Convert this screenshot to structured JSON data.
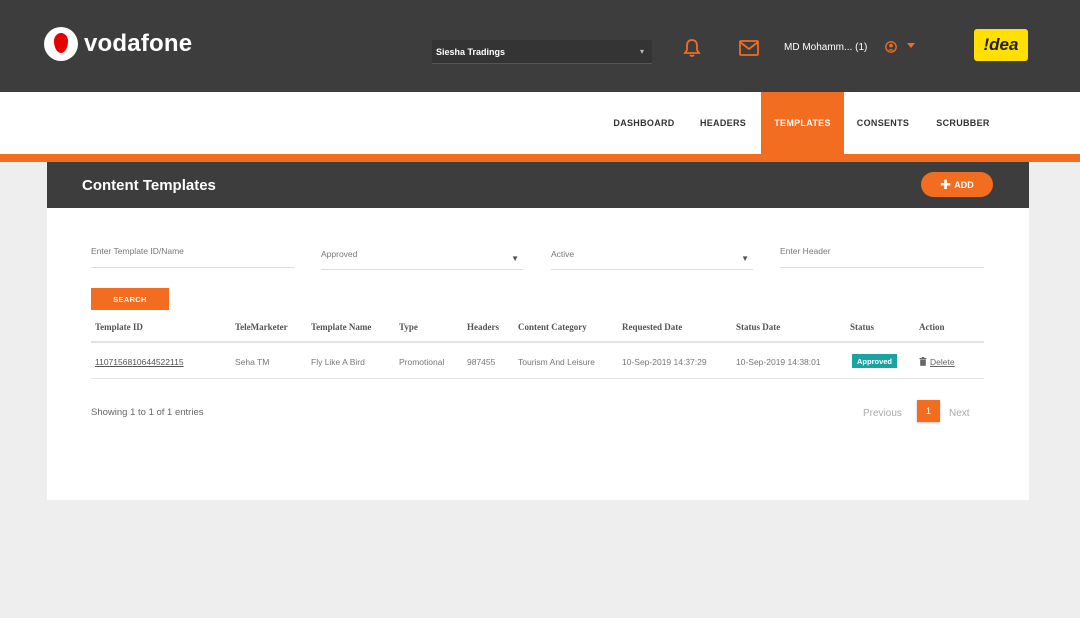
{
  "brand": {
    "name": "vodafone",
    "partner": "!dea"
  },
  "header": {
    "entity_select": "Siesha Tradings",
    "user_name": "MD Mohamm... (1)"
  },
  "nav": {
    "items": [
      {
        "label": "DASHBOARD"
      },
      {
        "label": "HEADERS"
      },
      {
        "label": "TEMPLATES"
      },
      {
        "label": "CONSENTS"
      },
      {
        "label": "SCRUBBER"
      }
    ],
    "active": "TEMPLATES"
  },
  "page": {
    "title": "Content Templates",
    "add_label": "ADD"
  },
  "filters": {
    "template_placeholder": "Enter Template ID/Name",
    "approval": "Approved",
    "state": "Active",
    "header_placeholder": "Enter Header",
    "search_label": "SEARCH"
  },
  "table": {
    "columns": [
      "Template ID",
      "TeleMarketer",
      "Template Name",
      "Type",
      "Headers",
      "Content Category",
      "Requested Date",
      "Status Date",
      "Status",
      "Action"
    ],
    "rows": [
      {
        "template_id": "1107156810644522115",
        "telemarketer": "Seha TM",
        "template_name": "Fly Like A Bird",
        "type": "Promotional",
        "headers": "987455",
        "category": "Tourism And Leisure",
        "requested_date": "10-Sep-2019 14:37:29",
        "status_date": "10-Sep-2019 14:38:01",
        "status": "Approved",
        "action": "Delete"
      }
    ]
  },
  "footer": {
    "entries": "Showing 1 to 1 of 1 entries",
    "previous": "Previous",
    "page": "1",
    "next": "Next"
  },
  "colors": {
    "accent": "#f26d1f",
    "dark": "#3d3d3d",
    "badge": "#1aa3a1",
    "brand_red": "#e60000",
    "partner_yellow": "#ffe000"
  }
}
